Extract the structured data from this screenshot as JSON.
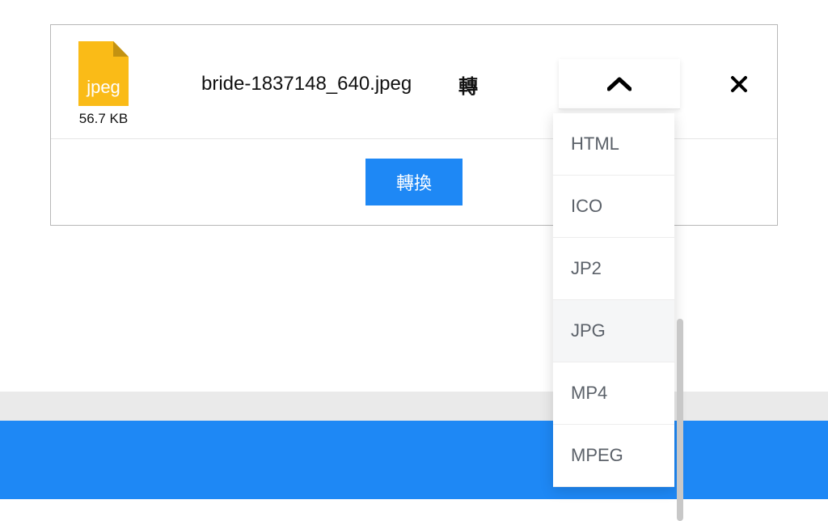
{
  "file": {
    "type_label": "jpeg",
    "name": "bride-1837148_640.jpeg",
    "size": "56.7 KB"
  },
  "labels": {
    "convert_word": "轉",
    "convert_button": "轉換"
  },
  "dropdown": {
    "options": [
      {
        "label": "HTML",
        "highlighted": false
      },
      {
        "label": "ICO",
        "highlighted": false
      },
      {
        "label": "JP2",
        "highlighted": false
      },
      {
        "label": "JPG",
        "highlighted": true
      },
      {
        "label": "MP4",
        "highlighted": false
      },
      {
        "label": "MPEG",
        "highlighted": false
      }
    ]
  },
  "colors": {
    "accent_blue": "#1e88f5",
    "file_icon_yellow": "#fabb17"
  }
}
